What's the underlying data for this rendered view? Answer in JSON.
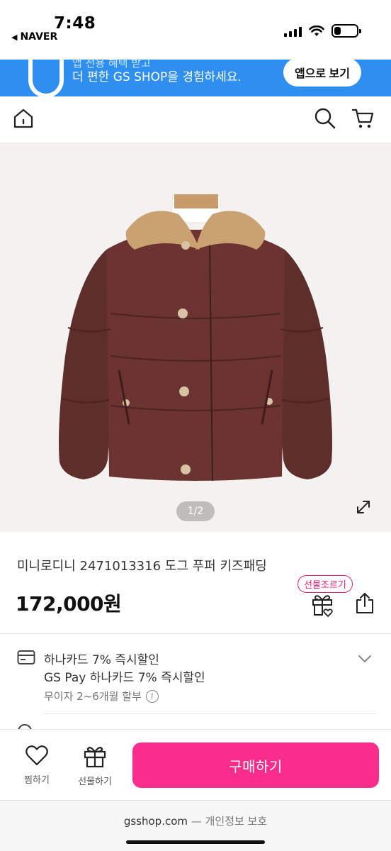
{
  "status_bar": {
    "time": "7:48",
    "back_app": "NAVER",
    "battery_level": 0.3
  },
  "app_banner": {
    "text_top": "앱 전용 혜택 받고",
    "text": "더 편한 GS SHOP을 경험하세요.",
    "button_label": "앱으로 보기",
    "color": "#2f8ff0"
  },
  "nav": {
    "icons": [
      "home-icon",
      "search-icon",
      "cart-icon"
    ]
  },
  "product": {
    "image_pager": "1/2",
    "title": "미니로디니 2471013316 도그 푸퍼 키즈패딩",
    "price": "172,000원",
    "gift_tag": "선물조르기"
  },
  "promotion": {
    "line1": "하나카드 7% 즉시할인",
    "line2": "GS Pay 하나카드 7% 즉시할인",
    "line3": "무이자 2~6개월 할부",
    "info_icon": "i"
  },
  "bottom_bar": {
    "wish_label": "찜하기",
    "gift_label": "선물하기",
    "buy_label": "구매하기",
    "buy_color": "#fa2d8c"
  },
  "browser": {
    "domain": "gsshop.com",
    "separator": "—",
    "privacy": "개인정보 보호"
  }
}
